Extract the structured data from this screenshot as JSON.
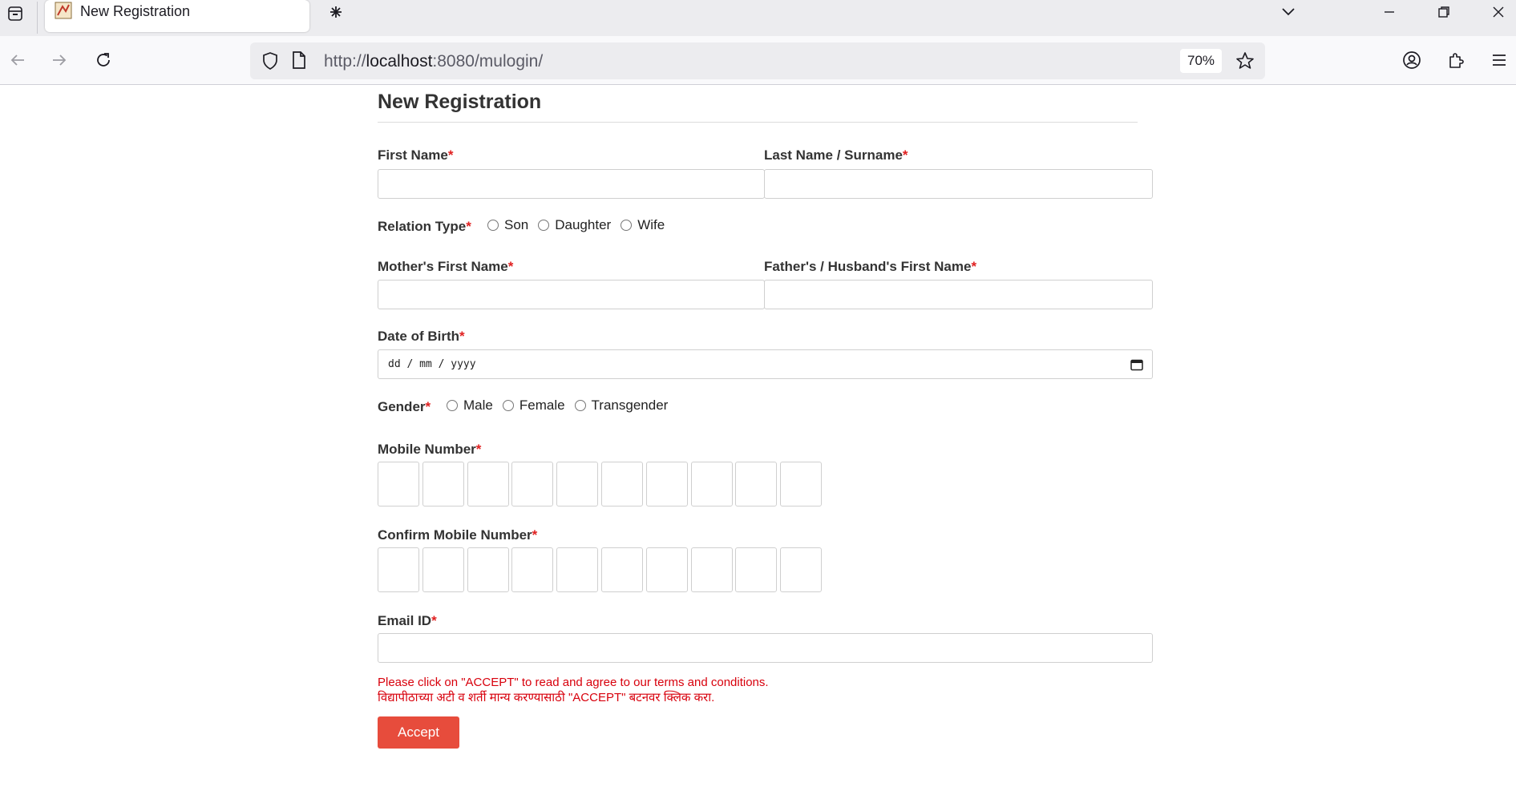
{
  "browser": {
    "tab_title": "New Registration",
    "url_scheme": "http://",
    "url_host": "localhost",
    "url_rest": ":8080/mulogin/",
    "zoom": "70%"
  },
  "form": {
    "heading": "New Registration",
    "required_mark": "*",
    "first_name_label": "First Name",
    "last_name_label": "Last Name / Surname",
    "relation_label": "Relation Type",
    "relation_options": [
      "Son",
      "Daughter",
      "Wife"
    ],
    "mother_name_label": "Mother's First Name",
    "father_name_label": "Father's / Husband's First Name",
    "dob_label": "Date of Birth",
    "dob_placeholder": "dd / mm / yyyy",
    "gender_label": "Gender",
    "gender_options": [
      "Male",
      "Female",
      "Transgender"
    ],
    "mobile_label": "Mobile Number",
    "confirm_mobile_label": "Confirm Mobile Number",
    "email_label": "Email ID",
    "notice_en": "Please click on \"ACCEPT\" to read and agree to our terms and conditions.",
    "notice_mr": "विद्यापीठाच्या अटी व शर्ती मान्य करण्यासाठी \"ACCEPT\" बटनवर क्लिक करा.",
    "accept_label": "Accept"
  },
  "colors": {
    "accent": "#e74c3c",
    "required": "#e02020",
    "notice": "#d8000c"
  }
}
